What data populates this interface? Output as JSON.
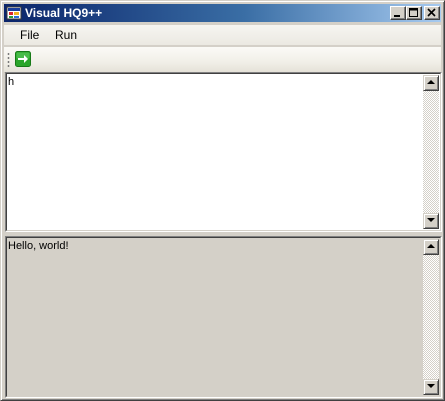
{
  "window": {
    "title": "Visual HQ9++"
  },
  "menu": {
    "items": [
      {
        "label": "File"
      },
      {
        "label": "Run"
      }
    ]
  },
  "toolbar": {
    "run_icon": "green-arrow-right-icon"
  },
  "editor": {
    "content": "h"
  },
  "output": {
    "content": "Hello, world!"
  },
  "colors": {
    "titlebar_start": "#0a246a",
    "titlebar_end": "#a6caf0",
    "run_icon": "#2aa52a",
    "output_bg": "#d4d0c8",
    "editor_bg": "#ffffff"
  }
}
